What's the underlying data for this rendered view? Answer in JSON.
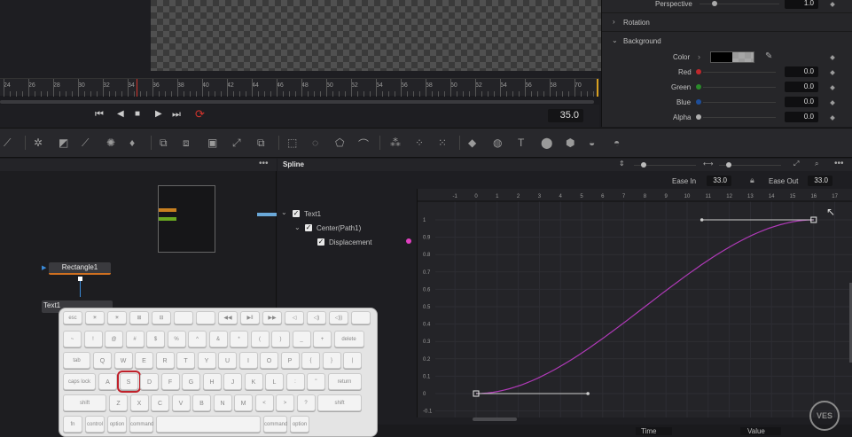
{
  "inspector": {
    "perspective_label": "Perspective",
    "perspective_value": "1.0",
    "rotation_label": "Rotation",
    "background_label": "Background",
    "color_label": "Color",
    "red_label": "Red",
    "red_value": "0.0",
    "green_label": "Green",
    "green_value": "0.0",
    "blue_label": "Blue",
    "blue_value": "0.0",
    "alpha_label": "Alpha",
    "alpha_value": "0.0"
  },
  "timeline": {
    "ticks": [
      "24",
      "26",
      "28",
      "30",
      "32",
      "34",
      "36",
      "38",
      "40",
      "42",
      "44",
      "46",
      "48",
      "50",
      "52",
      "54",
      "56",
      "58",
      "60",
      "62",
      "64",
      "66",
      "68",
      "70"
    ],
    "current_frame": "35.0"
  },
  "spline": {
    "panel_title": "Spline",
    "ease_in_label": "Ease In",
    "ease_in_value": "33.0",
    "ease_out_label": "Ease Out",
    "ease_out_value": "33.0",
    "tree": {
      "root": "Text1",
      "child": "Center(Path1)",
      "leaf": "Displacement"
    },
    "x_ticks": [
      "-1",
      "0",
      "1",
      "2",
      "3",
      "4",
      "5",
      "6",
      "7",
      "8",
      "9",
      "10",
      "11",
      "12",
      "13",
      "14",
      "15",
      "16",
      "17"
    ],
    "y_ticks": [
      "1",
      "0.9",
      "0.8",
      "0.7",
      "0.6",
      "0.5",
      "0.4",
      "0.3",
      "0.2",
      "0.1",
      "0",
      "-0.1"
    ],
    "bottom_time_label": "Time",
    "bottom_value_label": "Value"
  },
  "nodes": {
    "rectangle": "Rectangle1",
    "text": "Text1"
  },
  "keyboard": {
    "row0": [
      "esc",
      "☀",
      "☀",
      "⊞",
      "⊟",
      "",
      "",
      "◀◀",
      "▶‖",
      "▶▶",
      "◁",
      "◁)",
      "◁))",
      ""
    ],
    "row1": [
      "~",
      "!",
      "@",
      "#",
      "$",
      "%",
      "^",
      "&",
      "*",
      "(",
      ")",
      "_",
      "+",
      "delete"
    ],
    "row2": [
      "tab",
      "Q",
      "W",
      "E",
      "R",
      "T",
      "Y",
      "U",
      "I",
      "O",
      "P",
      "{",
      "}",
      "|"
    ],
    "row3": [
      "caps lock",
      "A",
      "S",
      "D",
      "F",
      "G",
      "H",
      "J",
      "K",
      "L",
      ":",
      "\"",
      "return"
    ],
    "row4": [
      "shift",
      "Z",
      "X",
      "C",
      "V",
      "B",
      "N",
      "M",
      "<",
      ">",
      "?",
      "shift"
    ],
    "row5": [
      "fn",
      "control",
      "option",
      "command",
      "",
      "command",
      "option"
    ],
    "highlight": "S"
  },
  "watermark": "VES",
  "colors": {
    "accent_red": "#d0342c",
    "curve": "#b03ab8",
    "pink_dot": "#e040c0",
    "highlight_box": "#c0202a"
  }
}
